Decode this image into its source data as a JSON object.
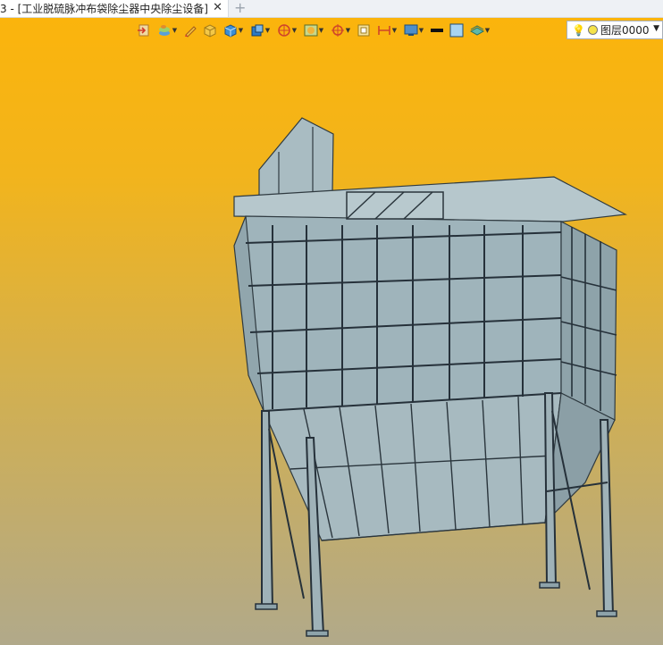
{
  "tab": {
    "title": "3 - [工业脱硫脉冲布袋除尘器中央除尘设备]",
    "close": "✕",
    "new_tab": "+"
  },
  "toolbar": {
    "icons": [
      "import-icon",
      "layers-icon",
      "pen-icon",
      "box-icon",
      "cube-color-icon",
      "view-cube-icon",
      "snap-icon",
      "render-icon",
      "target-icon",
      "frame-icon",
      "dimension-icon",
      "display-icon",
      "line-color-icon",
      "fill-color-icon",
      "material-icon"
    ],
    "layer": {
      "name": "图层0000"
    }
  }
}
